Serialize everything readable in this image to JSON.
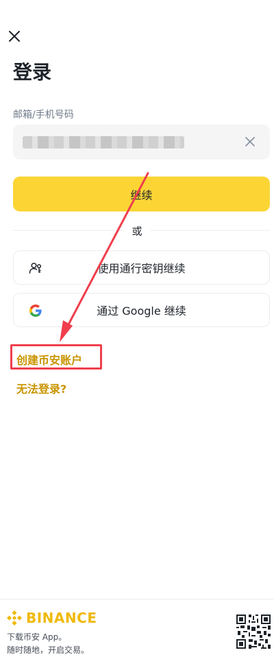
{
  "title": "登录",
  "email_field": {
    "label": "邮箱/手机号码",
    "value": ""
  },
  "continue_label": "继续",
  "or_label": "或",
  "passkey_label": "使用通行密钥继续",
  "google_label": "通过 Google 继续",
  "create_account_label": "创建币安账户",
  "cant_login_label": "无法登录?",
  "footer": {
    "brand": "BINANCE",
    "line1": "下载币安 App。",
    "line2": "随时随地，开启交易。"
  },
  "colors": {
    "accent": "#fcd535",
    "link": "#c99400",
    "annotation": "#f03e4c",
    "brand": "#f0b90b"
  },
  "icons": [
    "close-icon",
    "clear-icon",
    "passkey-icon",
    "google-icon",
    "binance-logo-icon",
    "qr-code-icon"
  ]
}
